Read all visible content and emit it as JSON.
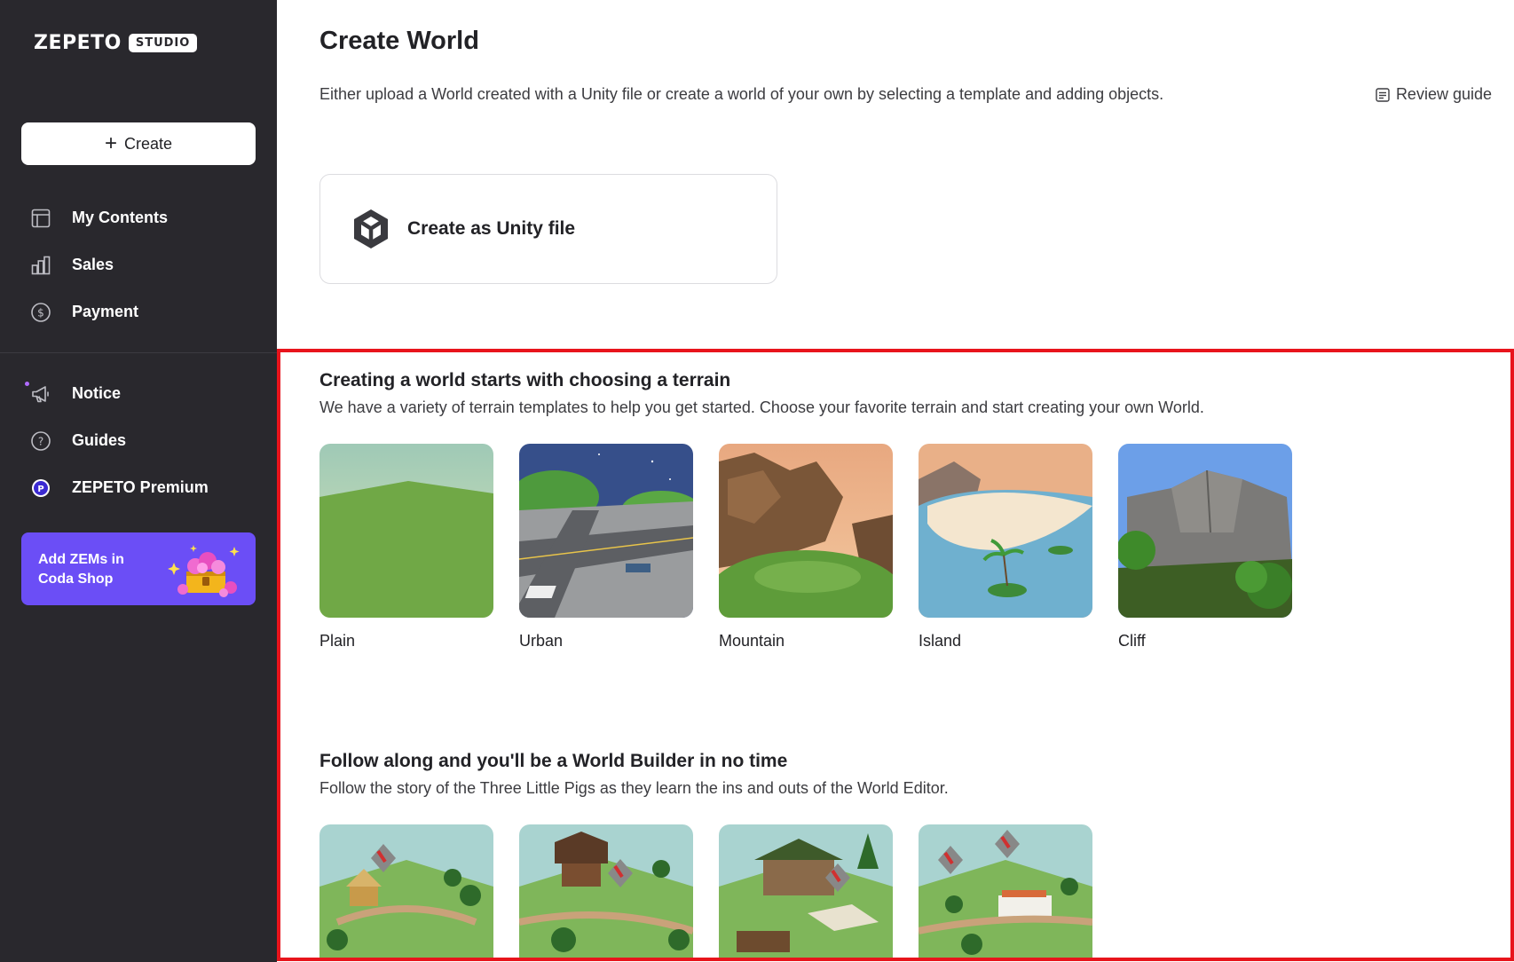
{
  "sidebar": {
    "logo": {
      "word": "ZEPETO",
      "badge": "STUDIO"
    },
    "create_label": "Create",
    "nav_primary": [
      {
        "label": "My Contents",
        "icon": "layout-icon"
      },
      {
        "label": "Sales",
        "icon": "bar-chart-icon"
      },
      {
        "label": "Payment",
        "icon": "dollar-circle-icon"
      }
    ],
    "nav_secondary": [
      {
        "label": "Notice",
        "icon": "megaphone-icon"
      },
      {
        "label": "Guides",
        "icon": "question-circle-icon"
      },
      {
        "label": "ZEPETO Premium",
        "icon": "premium-badge-icon"
      }
    ],
    "promo": {
      "line1": "Add ZEMs in",
      "line2": "Coda Shop"
    }
  },
  "main": {
    "title": "Create World",
    "description": "Either upload a World created with a Unity file or create a world of your own by selecting a template and adding objects.",
    "review_guide": "Review guide",
    "unity_card_label": "Create as Unity file",
    "terrain": {
      "title": "Creating a world starts with choosing a terrain",
      "description": "We have a variety of terrain templates to help you get started. Choose your favorite terrain and start creating your own World.",
      "cards": [
        {
          "name": "Plain"
        },
        {
          "name": "Urban"
        },
        {
          "name": "Mountain"
        },
        {
          "name": "Island"
        },
        {
          "name": "Cliff"
        }
      ]
    },
    "tutorial": {
      "title": "Follow along and you'll be a World Builder in no time",
      "description": "Follow the story of the Three Little Pigs as they learn the ins and outs of the World Editor."
    }
  },
  "colors": {
    "sidebar_bg": "#29282d",
    "promo_bg": "#6b4ef6",
    "highlight": "#e8141c"
  }
}
